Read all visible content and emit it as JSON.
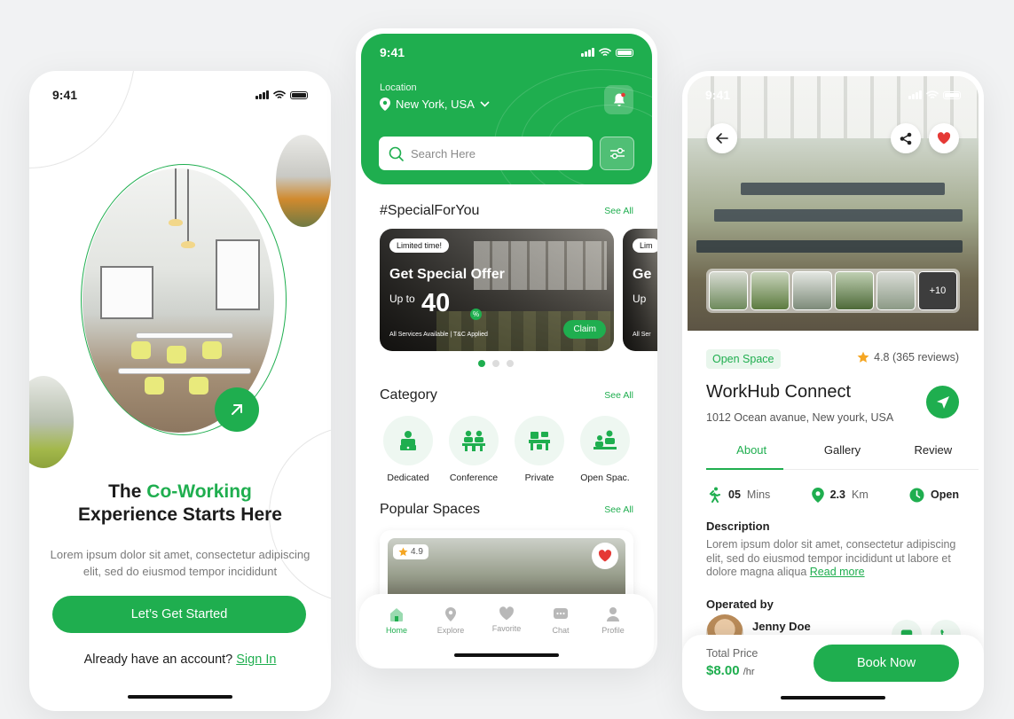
{
  "colors": {
    "accent": "#1fae4f",
    "accent_light": "#eef7f1",
    "background": "#f1f2f3"
  },
  "onboarding": {
    "time": "9:41",
    "title_pre": "The ",
    "title_highlight": "Co-Working",
    "title_line2": "Experience Starts Here",
    "description": "Lorem ipsum dolor sit amet, consectetur adipiscing elit, sed do eiusmod tempor incididunt",
    "cta_label": "Let’s Get Started",
    "signin_prompt": "Already have an account?",
    "signin_link": "Sign In"
  },
  "home": {
    "time": "9:41",
    "location_label": "Location",
    "location_value": "New York, USA",
    "search_placeholder": "Search Here",
    "special_title": "#SpecialForYou",
    "special_see_all": "See All",
    "offer": {
      "badge": "Limited time!",
      "title": "Get Special Offer",
      "upto": "Up to",
      "value": "40",
      "percent_symbol": "%",
      "fine_print": "All Services Available | T&C Applied",
      "claim": "Claim"
    },
    "offer_peek": {
      "badge": "Lim",
      "title": "Ge",
      "upto": "Up",
      "fine_print": "All Ser"
    },
    "category_title": "Category",
    "category_see_all": "See All",
    "categories": [
      {
        "label": "Dedicated",
        "icon": "dedicated-desk-icon"
      },
      {
        "label": "Conference",
        "icon": "conference-icon"
      },
      {
        "label": "Private",
        "icon": "private-office-icon"
      },
      {
        "label": "Open Spac.",
        "icon": "open-space-icon"
      }
    ],
    "popular_title": "Popular Spaces",
    "popular_see_all": "See All",
    "popular_rating": "4.9",
    "tabs": [
      {
        "label": "Home",
        "icon": "home-icon",
        "active": true
      },
      {
        "label": "Explore",
        "icon": "explore-icon"
      },
      {
        "label": "Favorite",
        "icon": "heart-icon"
      },
      {
        "label": "Chat",
        "icon": "chat-icon"
      },
      {
        "label": "Profile",
        "icon": "profile-icon"
      }
    ]
  },
  "detail": {
    "time": "9:41",
    "more_photos": "+10",
    "tag": "Open Space",
    "rating": "4.8 (365 reviews)",
    "title": "WorkHub Connect",
    "address": "1012 Ocean avanue, New yourk, USA",
    "tabs": [
      "About",
      "Gallery",
      "Review"
    ],
    "stats": [
      {
        "value": "05",
        "unit": "Mins",
        "icon": "walking-icon"
      },
      {
        "value": "2.3",
        "unit": "Km",
        "icon": "location-pin-icon"
      },
      {
        "value": "Open",
        "unit": "",
        "icon": "clock-icon"
      }
    ],
    "description_heading": "Description",
    "description": "Lorem ipsum dolor sit amet, consectetur adipiscing elit, sed do eiusmod tempor incididunt ut labore et dolore magna aliqua",
    "read_more": "Read more",
    "operated_heading": "Operated by",
    "operator_name": "Jenny Doe",
    "total_price_label": "Total Price",
    "price": "$8.00",
    "price_unit": "/hr",
    "book_label": "Book Now"
  }
}
